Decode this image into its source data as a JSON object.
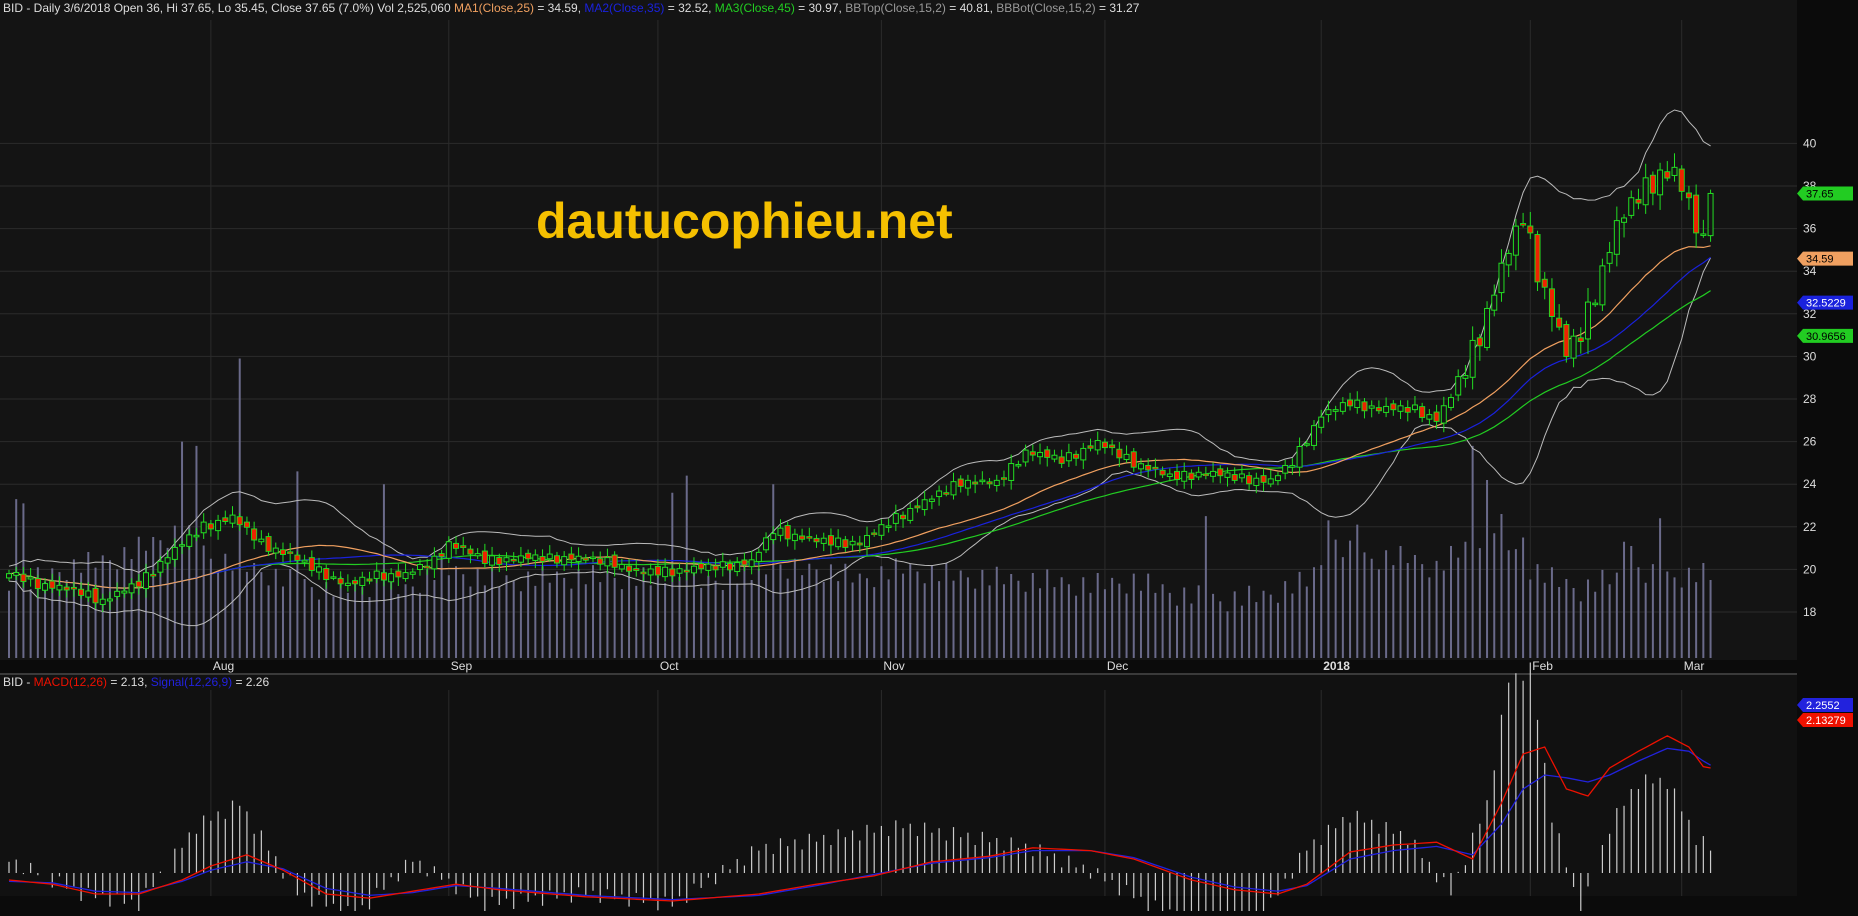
{
  "colors": {
    "background_price": "#141414",
    "background_macd": "#111111",
    "grid": "#2b2b2b",
    "up_candle": "#22dd22",
    "down_candle": "#ee2200",
    "ma1": "#f0a060",
    "ma2": "#1a22dd",
    "ma3": "#22cc22",
    "bollinger": "#bbbbbb",
    "volume": "#6a6a8a",
    "macd_line": "#ee1100",
    "signal_line": "#2222dd",
    "histogram": "#cccccc",
    "watermark": "#f5c000",
    "axis_text": "#dddddd"
  },
  "header": {
    "prefix": "BID - Daily 3/6/2018 Open 36, Hi 37.65, Lo 35.45, Close 37.65 (7.0%) Vol 2,525,060 ",
    "ma1_label": "MA1(Close,25)",
    "ma1_value": " = 34.59, ",
    "ma2_label": "MA2(Close,35)",
    "ma2_value": " = 32.52, ",
    "ma3_label": "MA3(Close,45)",
    "ma3_value": " = 30.97, ",
    "bbtop_label": "BBTop(Close,15,2)",
    "bbtop_value": " = 40.81, ",
    "bbbot_label": "BBBot(Close,15,2)",
    "bbbot_value": " = 31.27"
  },
  "macd_header": {
    "prefix": "BID - ",
    "macd_label": "MACD(12,26)",
    "macd_value": " = 2.13, ",
    "signal_label": "Signal(12,26,9)",
    "signal_value": " = 2.26"
  },
  "watermark": "dautucophieu.net",
  "chart_data": [
    {
      "type": "candlestick",
      "title": "BID - Daily 3/6/2018",
      "ylim": [
        15,
        42
      ],
      "y_ticks": [
        18,
        20,
        22,
        24,
        26,
        28,
        30,
        32,
        34,
        36,
        38,
        40
      ],
      "x_tick_labels": [
        {
          "label": "Aug",
          "index": 28
        },
        {
          "label": "Sep",
          "index": 61
        },
        {
          "label": "Oct",
          "index": 90
        },
        {
          "label": "Nov",
          "index": 121
        },
        {
          "label": "Dec",
          "index": 152
        },
        {
          "label": "2018",
          "index": 182
        },
        {
          "label": "Feb",
          "index": 211
        },
        {
          "label": "Mar",
          "index": 232
        }
      ],
      "last_values": {
        "close": "37.65",
        "ma1": "34.59",
        "ma2": "32.5229",
        "ma3": "30.9656"
      },
      "price_anchors": [
        [
          0,
          19.8
        ],
        [
          4,
          19.3
        ],
        [
          10,
          18.9
        ],
        [
          13,
          18.5
        ],
        [
          18,
          19.3
        ],
        [
          22,
          20.6
        ],
        [
          27,
          22.0
        ],
        [
          31,
          22.4
        ],
        [
          35,
          21.2
        ],
        [
          39,
          20.6
        ],
        [
          43,
          19.9
        ],
        [
          47,
          19.2
        ],
        [
          51,
          19.7
        ],
        [
          55,
          19.7
        ],
        [
          59,
          20.4
        ],
        [
          61,
          21.2
        ],
        [
          66,
          20.4
        ],
        [
          72,
          20.5
        ],
        [
          78,
          20.5
        ],
        [
          84,
          20.3
        ],
        [
          87,
          19.8
        ],
        [
          92,
          19.9
        ],
        [
          98,
          20.1
        ],
        [
          103,
          20.3
        ],
        [
          106,
          21.8
        ],
        [
          112,
          21.3
        ],
        [
          118,
          21.2
        ],
        [
          123,
          22.4
        ],
        [
          128,
          23.3
        ],
        [
          132,
          24.1
        ],
        [
          137,
          24.0
        ],
        [
          141,
          25.5
        ],
        [
          146,
          25.1
        ],
        [
          151,
          25.9
        ],
        [
          156,
          25.0
        ],
        [
          161,
          24.3
        ],
        [
          166,
          24.5
        ],
        [
          170,
          24.3
        ],
        [
          175,
          24.1
        ],
        [
          178,
          25.0
        ],
        [
          182,
          27.2
        ],
        [
          186,
          27.8
        ],
        [
          190,
          27.5
        ],
        [
          195,
          27.5
        ],
        [
          198,
          27.0
        ],
        [
          201,
          28.6
        ],
        [
          204,
          31.0
        ],
        [
          207,
          34.0
        ],
        [
          210,
          36.5
        ],
        [
          212,
          34.0
        ],
        [
          214,
          32.0
        ],
        [
          216,
          30.0
        ],
        [
          218,
          31.0
        ],
        [
          221,
          34.0
        ],
        [
          223,
          36.0
        ],
        [
          226,
          37.5
        ],
        [
          229,
          38.5
        ],
        [
          231,
          38.5
        ],
        [
          233,
          37.0
        ],
        [
          235,
          35.2
        ],
        [
          236,
          37.65
        ]
      ],
      "volume_anchors": [
        [
          0,
          19.0
        ],
        [
          8,
          20.0
        ],
        [
          15,
          20.5
        ],
        [
          24,
          21.8
        ],
        [
          28,
          20.5
        ],
        [
          34,
          20.0
        ],
        [
          38,
          19.5
        ],
        [
          44,
          19.0
        ],
        [
          50,
          19.2
        ],
        [
          55,
          19.0
        ],
        [
          60,
          20.0
        ],
        [
          68,
          19.4
        ],
        [
          76,
          19.6
        ],
        [
          84,
          19.6
        ],
        [
          88,
          19.5
        ],
        [
          94,
          19.2
        ],
        [
          100,
          19.6
        ],
        [
          106,
          19.8
        ],
        [
          112,
          20.0
        ],
        [
          118,
          19.5
        ],
        [
          124,
          20.0
        ],
        [
          130,
          19.7
        ],
        [
          138,
          19.5
        ],
        [
          144,
          19.4
        ],
        [
          150,
          19.2
        ],
        [
          156,
          19.4
        ],
        [
          162,
          18.8
        ],
        [
          168,
          18.5
        ],
        [
          174,
          18.7
        ],
        [
          180,
          19.4
        ],
        [
          184,
          21.0
        ],
        [
          188,
          20.5
        ],
        [
          194,
          20.5
        ],
        [
          198,
          20.0
        ],
        [
          202,
          21.0
        ],
        [
          206,
          22.0
        ],
        [
          210,
          20.2
        ],
        [
          214,
          19.5
        ],
        [
          218,
          19.0
        ],
        [
          222,
          19.5
        ],
        [
          226,
          19.7
        ],
        [
          230,
          19.6
        ],
        [
          234,
          19.7
        ],
        [
          236,
          19.7
        ]
      ],
      "volume_spikes": [
        [
          1,
          23.3
        ],
        [
          2,
          23.1
        ],
        [
          24,
          26.0
        ],
        [
          26,
          25.8
        ],
        [
          32,
          29.9
        ],
        [
          40,
          24.6
        ],
        [
          52,
          24.0
        ],
        [
          92,
          23.6
        ],
        [
          94,
          24.4
        ],
        [
          106,
          24.0
        ],
        [
          166,
          22.5
        ],
        [
          183,
          22.3
        ],
        [
          187,
          22.1
        ],
        [
          203,
          25.8
        ],
        [
          205,
          24.2
        ],
        [
          207,
          22.6
        ],
        [
          210,
          21.5
        ],
        [
          224,
          21.3
        ],
        [
          225,
          21.1
        ],
        [
          229,
          22.4
        ]
      ]
    },
    {
      "type": "line",
      "title": "MACD(12,26) / Signal(12,26,9)",
      "last_values": {
        "macd": "2.13279",
        "signal": "2.2552"
      },
      "macd_anchors": [
        [
          0,
          -0.5
        ],
        [
          6,
          -0.8
        ],
        [
          12,
          -1.5
        ],
        [
          18,
          -1.5
        ],
        [
          24,
          -0.5
        ],
        [
          28,
          0.5
        ],
        [
          33,
          1.3
        ],
        [
          38,
          0.2
        ],
        [
          44,
          -1.5
        ],
        [
          50,
          -1.8
        ],
        [
          56,
          -1.3
        ],
        [
          62,
          -0.8
        ],
        [
          68,
          -1.2
        ],
        [
          80,
          -1.7
        ],
        [
          92,
          -2.0
        ],
        [
          104,
          -1.5
        ],
        [
          112,
          -0.8
        ],
        [
          120,
          -0.2
        ],
        [
          128,
          0.8
        ],
        [
          136,
          1.2
        ],
        [
          142,
          1.8
        ],
        [
          150,
          1.6
        ],
        [
          156,
          1.0
        ],
        [
          164,
          -0.5
        ],
        [
          170,
          -1.2
        ],
        [
          176,
          -1.5
        ],
        [
          180,
          -0.8
        ],
        [
          186,
          1.5
        ],
        [
          192,
          2.0
        ],
        [
          198,
          2.2
        ],
        [
          203,
          1.0
        ],
        [
          207,
          5.0
        ],
        [
          210,
          8.5
        ],
        [
          213,
          9.0
        ],
        [
          216,
          6.0
        ],
        [
          219,
          5.5
        ],
        [
          222,
          7.5
        ],
        [
          226,
          8.7
        ],
        [
          230,
          9.8
        ],
        [
          233,
          9.0
        ],
        [
          235,
          7.6
        ],
        [
          236,
          7.5
        ]
      ],
      "signal_anchors": [
        [
          0,
          -0.6
        ],
        [
          6,
          -0.7
        ],
        [
          12,
          -1.3
        ],
        [
          18,
          -1.4
        ],
        [
          24,
          -0.6
        ],
        [
          28,
          0.2
        ],
        [
          33,
          0.8
        ],
        [
          38,
          0.3
        ],
        [
          44,
          -1.1
        ],
        [
          50,
          -1.6
        ],
        [
          56,
          -1.4
        ],
        [
          62,
          -0.9
        ],
        [
          68,
          -1.1
        ],
        [
          80,
          -1.6
        ],
        [
          92,
          -1.9
        ],
        [
          104,
          -1.6
        ],
        [
          112,
          -0.9
        ],
        [
          120,
          -0.1
        ],
        [
          128,
          0.7
        ],
        [
          136,
          1.1
        ],
        [
          142,
          1.6
        ],
        [
          150,
          1.6
        ],
        [
          156,
          1.1
        ],
        [
          164,
          -0.3
        ],
        [
          170,
          -1.0
        ],
        [
          176,
          -1.3
        ],
        [
          180,
          -0.9
        ],
        [
          186,
          1.0
        ],
        [
          192,
          1.6
        ],
        [
          198,
          1.9
        ],
        [
          203,
          1.3
        ],
        [
          207,
          3.5
        ],
        [
          210,
          6.0
        ],
        [
          213,
          7.0
        ],
        [
          216,
          6.8
        ],
        [
          219,
          6.5
        ],
        [
          222,
          7.0
        ],
        [
          226,
          8.0
        ],
        [
          230,
          8.9
        ],
        [
          233,
          8.7
        ],
        [
          235,
          8.0
        ],
        [
          236,
          7.7
        ]
      ],
      "histogram_anchors": [
        [
          0,
          0.1
        ],
        [
          10,
          -0.2
        ],
        [
          18,
          -0.3
        ],
        [
          26,
          0.4
        ],
        [
          32,
          0.6
        ],
        [
          40,
          -0.2
        ],
        [
          48,
          -0.4
        ],
        [
          56,
          0.1
        ],
        [
          66,
          -0.3
        ],
        [
          80,
          -0.2
        ],
        [
          92,
          -0.3
        ],
        [
          104,
          0.2
        ],
        [
          114,
          0.3
        ],
        [
          124,
          0.4
        ],
        [
          134,
          0.3
        ],
        [
          142,
          0.2
        ],
        [
          150,
          0.0
        ],
        [
          158,
          -0.3
        ],
        [
          166,
          -0.5
        ],
        [
          174,
          -0.4
        ],
        [
          180,
          0.2
        ],
        [
          186,
          0.5
        ],
        [
          194,
          0.3
        ],
        [
          200,
          -0.2
        ],
        [
          205,
          0.6
        ],
        [
          208,
          1.7
        ],
        [
          211,
          1.8
        ],
        [
          214,
          0.5
        ],
        [
          218,
          -0.4
        ],
        [
          222,
          0.4
        ],
        [
          226,
          0.8
        ],
        [
          230,
          0.8
        ],
        [
          234,
          0.3
        ],
        [
          236,
          0.2
        ]
      ]
    }
  ]
}
